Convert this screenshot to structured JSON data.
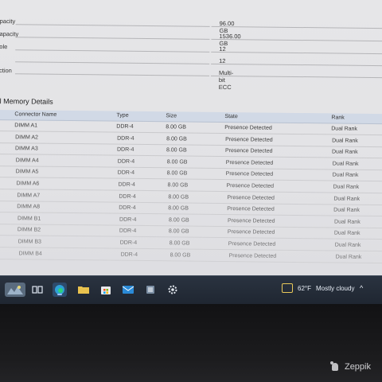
{
  "summary": [
    {
      "label": "pacity",
      "value": "96.00 GB"
    },
    {
      "label": "apacity",
      "value": "1536.00 GB"
    },
    {
      "label": "ole",
      "value": "12"
    },
    {
      "label": "",
      "value": "12"
    },
    {
      "label": "ction",
      "value": "Multi-bit ECC"
    }
  ],
  "section_title": "al Memory Details",
  "table": {
    "columns": [
      "Connector Name",
      "Type",
      "Size",
      "State",
      "Rank"
    ],
    "rows": [
      [
        "DIMM A1",
        "DDR-4",
        "8.00 GB",
        "Presence Detected",
        "Dual Rank"
      ],
      [
        "DIMM A2",
        "DDR-4",
        "8.00 GB",
        "Presence Detected",
        "Dual Rank"
      ],
      [
        "DIMM A3",
        "DDR-4",
        "8.00 GB",
        "Presence Detected",
        "Dual Rank"
      ],
      [
        "DIMM A4",
        "DDR-4",
        "8.00 GB",
        "Presence Detected",
        "Dual Rank"
      ],
      [
        "DIMM A5",
        "DDR-4",
        "8.00 GB",
        "Presence Detected",
        "Dual Rank"
      ],
      [
        "DIMM A6",
        "DDR-4",
        "8.00 GB",
        "Presence Detected",
        "Dual Rank"
      ],
      [
        "DIMM A7",
        "DDR-4",
        "8.00 GB",
        "Presence Detected",
        "Dual Rank"
      ],
      [
        "DIMM A8",
        "DDR-4",
        "8.00 GB",
        "Presence Detected",
        "Dual Rank"
      ],
      [
        "DIMM B1",
        "DDR-4",
        "8.00 GB",
        "Presence Detected",
        "Dual Rank"
      ],
      [
        "DIMM B2",
        "DDR-4",
        "8.00 GB",
        "Presence Detected",
        "Dual Rank"
      ],
      [
        "DIMM B3",
        "DDR-4",
        "8.00 GB",
        "Presence Detected",
        "Dual Rank"
      ],
      [
        "DIMM B4",
        "DDR-4",
        "8.00 GB",
        "Presence Detected",
        "Dual Rank"
      ]
    ]
  },
  "taskbar": {
    "icons": [
      "widgets-icon",
      "task-view-icon",
      "edge-browser-icon",
      "file-explorer-icon",
      "store-icon",
      "mail-icon",
      "app-icon",
      "app-icon-2",
      "settings-icon"
    ],
    "weather_temp": "62°F",
    "weather_desc": "Mostly cloudy",
    "tray_chevron": "^"
  },
  "watermark": "Zeppik",
  "colors": {
    "table_header": "#d1d9e6",
    "taskbar": "#1f2631",
    "accent": "#9cc3ff"
  }
}
